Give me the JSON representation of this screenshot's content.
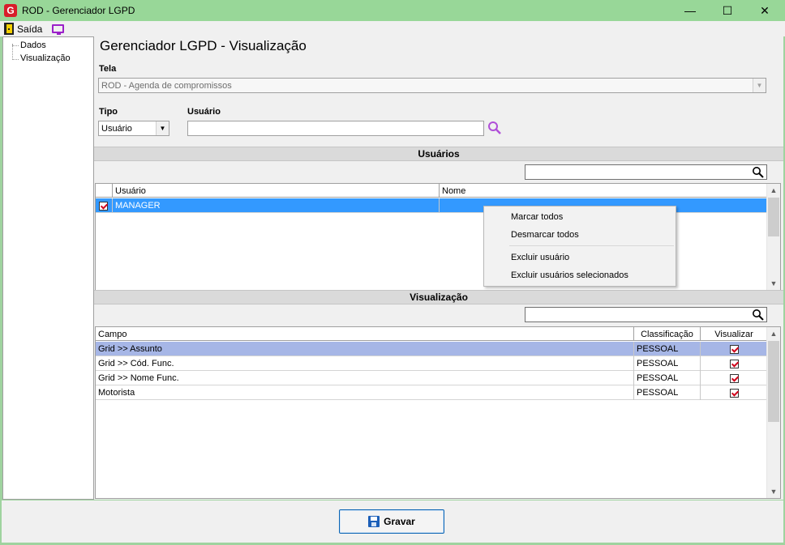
{
  "window": {
    "title": "ROD - Gerenciador LGPD",
    "logo_letter": "G",
    "minimize_glyph": "—",
    "maximize_glyph": "☐",
    "close_glyph": "✕"
  },
  "menubar": {
    "exit_label": "Saída"
  },
  "tree": {
    "items": [
      {
        "label": "Dados"
      },
      {
        "label": "Visualização"
      }
    ]
  },
  "main": {
    "title": "Gerenciador LGPD - Visualização",
    "tela": {
      "label": "Tela",
      "value": "ROD - Agenda de compromissos"
    },
    "tipo": {
      "label": "Tipo",
      "value": "Usuário"
    },
    "usuario": {
      "label": "Usuário",
      "value": ""
    }
  },
  "users_section": {
    "header": "Usuários",
    "search_value": "",
    "columns": [
      "Usuário",
      "Nome"
    ],
    "rows": [
      {
        "checked": true,
        "usuario": "MANAGER",
        "nome": ""
      }
    ]
  },
  "context_menu": {
    "items": [
      {
        "label": "Marcar todos"
      },
      {
        "label": "Desmarcar todos"
      },
      {
        "label": "Excluir usuário"
      },
      {
        "label": "Excluir usuários selecionados"
      }
    ]
  },
  "view_section": {
    "header": "Visualização",
    "search_value": "",
    "columns": [
      "Campo",
      "Classificação",
      "Visualizar"
    ],
    "rows": [
      {
        "campo": "Grid >> Assunto",
        "classificacao": "PESSOAL",
        "visualizar": true
      },
      {
        "campo": "Grid >> Cód. Func.",
        "classificacao": "PESSOAL",
        "visualizar": true
      },
      {
        "campo": "Grid >> Nome Func.",
        "classificacao": "PESSOAL",
        "visualizar": true
      },
      {
        "campo": "Motorista",
        "classificacao": "PESSOAL",
        "visualizar": true
      }
    ]
  },
  "footer": {
    "save_label": "Gravar"
  },
  "colors": {
    "window_frame": "#9fd39f",
    "selection_blue": "#3399ff",
    "selection_light": "#a6b6e6",
    "check_red": "#d0021b",
    "lookup_purple": "#b04fd8"
  }
}
